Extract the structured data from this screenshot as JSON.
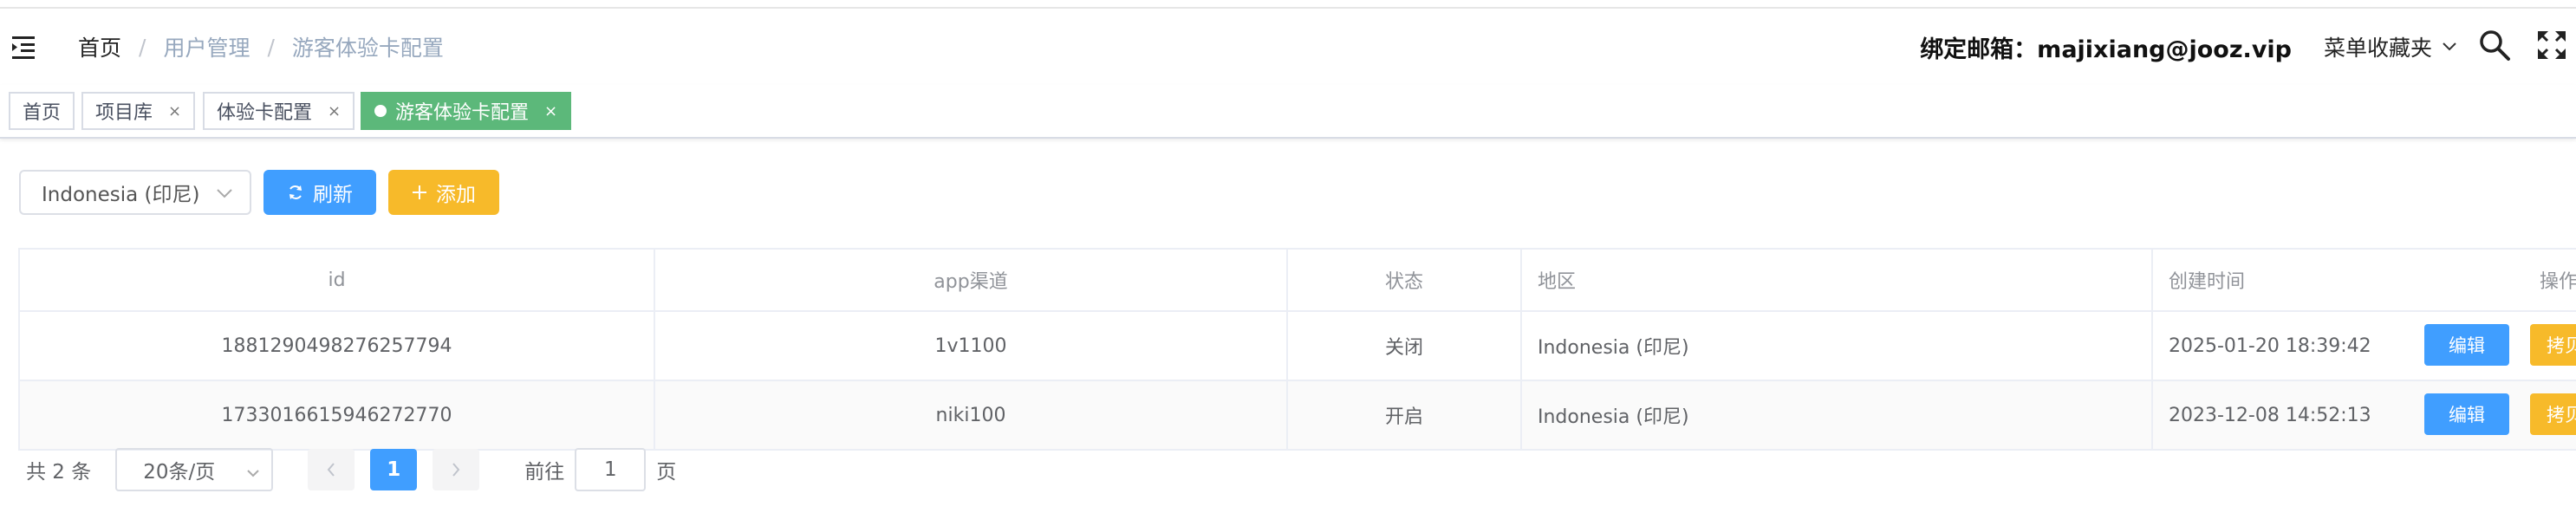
{
  "header": {
    "breadcrumb": [
      "首页",
      "用户管理",
      "游客体验卡配置"
    ],
    "breadcrumb_sep": "/",
    "email": "绑定邮箱：majixiang@jooz.vip",
    "favorites": "菜单收藏夹",
    "icons": [
      "menu-fold-icon",
      "chevron-down-icon",
      "search-icon",
      "fullscreen-icon"
    ]
  },
  "tags": [
    {
      "label": "首页",
      "closable": false,
      "active": false
    },
    {
      "label": "项目库",
      "closable": true,
      "active": false
    },
    {
      "label": "体验卡配置",
      "closable": true,
      "active": false
    },
    {
      "label": "游客体验卡配置",
      "closable": true,
      "active": true
    }
  ],
  "tag_close": "×",
  "toolbar": {
    "region_select": "Indonesia (印尼)",
    "refresh_label": "刷新",
    "add_label": "添加"
  },
  "table": {
    "columns": [
      "id",
      "app渠道",
      "状态",
      "地区",
      "创建时间",
      "操作"
    ],
    "rows": [
      {
        "id": "1881290498276257794",
        "app": "1v1100",
        "status": "关闭",
        "region": "Indonesia (印尼)",
        "created": "2025-01-20 18:39:42",
        "edit": "编辑",
        "copy": "拷贝"
      },
      {
        "id": "1733016615946272770",
        "app": "niki100",
        "status": "开启",
        "region": "Indonesia (印尼)",
        "created": "2023-12-08 14:52:13",
        "edit": "编辑",
        "copy": "拷贝"
      }
    ]
  },
  "pagination": {
    "total": "共 2 条",
    "page_size": "20条/页",
    "current_page": "1",
    "goto_prefix": "前往",
    "goto_value": "1",
    "goto_suffix": "页"
  },
  "colors": {
    "primary": "#409eff",
    "warning": "#f7ba2a",
    "active_tag": "#5cb87a"
  }
}
